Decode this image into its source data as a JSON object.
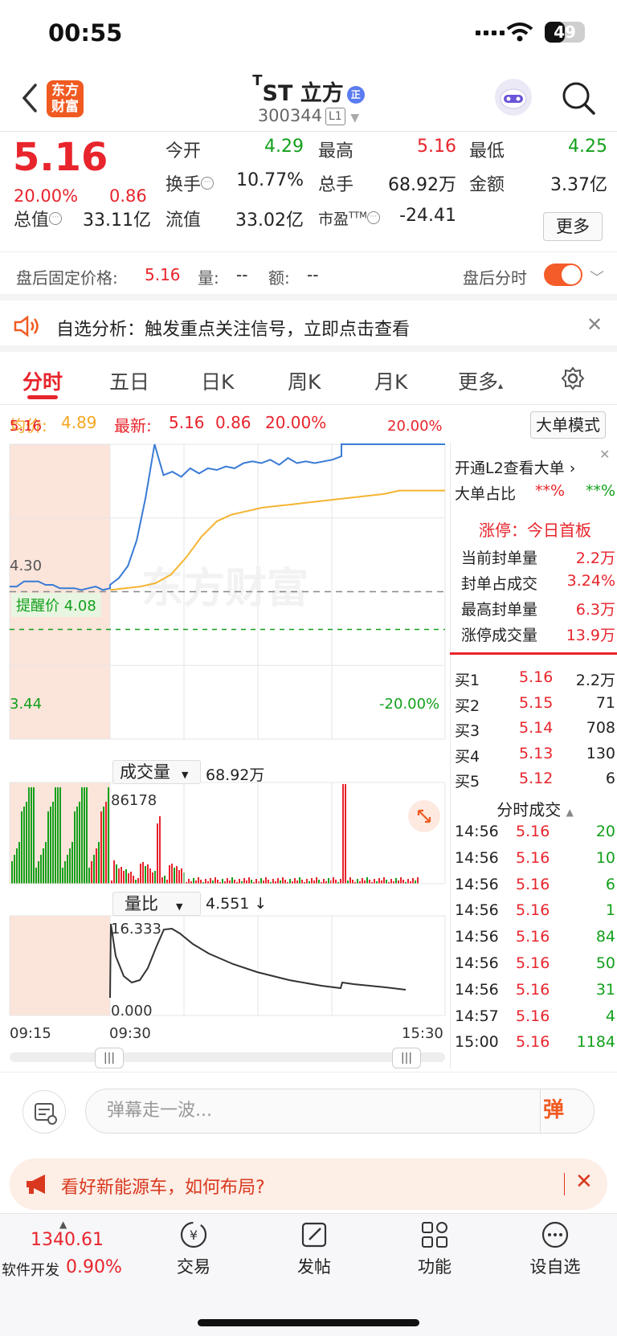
{
  "status": {
    "time": "00:55",
    "battery": "49",
    "battery_level": 0.49
  },
  "nav": {
    "title_sup": "T",
    "title": "ST 立方",
    "badge": "正",
    "code": "300344",
    "level": "L1",
    "logo_line1": "东方",
    "logo_line2": "财富"
  },
  "quote": {
    "price": "5.16",
    "pct": "20.00%",
    "change": "0.86",
    "open_label": "今开",
    "open": "4.29",
    "high_label": "最高",
    "high": "5.16",
    "low_label": "最低",
    "low": "4.25",
    "turnover_label": "换手",
    "turnover": "10.77%",
    "volume_label": "总手",
    "volume": "68.92万",
    "amount_label": "金额",
    "amount": "3.37亿",
    "mcap_label": "总值",
    "mcap": "33.11亿",
    "float_label": "流值",
    "float": "33.02亿",
    "pe_label": "市盈",
    "pe_sup": "TTM",
    "pe": "-24.41",
    "more": "更多"
  },
  "after_hours": {
    "label": "盘后固定价格:",
    "price": "5.16",
    "vol_label": "量:",
    "vol": "--",
    "amt_label": "额:",
    "amt": "--",
    "timeshare": "盘后分时"
  },
  "alert": {
    "text": "自选分析：触发重点关注信号，立即点击查看"
  },
  "tabs": [
    "分时",
    "五日",
    "日K",
    "周K",
    "月K",
    "更多"
  ],
  "legend": {
    "avg_label": "均价:",
    "avg": "4.89",
    "latest_label": "最新:",
    "latest": "5.16",
    "chg": "0.86",
    "pct": "20.00%",
    "mode": "大单模式"
  },
  "chart_data": {
    "type": "line",
    "price_axis": {
      "top": "5.16",
      "base": "4.30",
      "bottom": "3.44",
      "top_pct": "20.00%",
      "bottom_pct": "-20.00%",
      "ylim": [
        3.44,
        5.16
      ]
    },
    "alert_price_label": "提醒价 4.08",
    "alert_price": 4.08,
    "times": [
      "09:15",
      "09:30",
      "15:30"
    ],
    "price": [
      4.33,
      4.33,
      4.36,
      4.36,
      4.36,
      4.34,
      4.34,
      4.32,
      4.32,
      4.32,
      4.31,
      4.32,
      4.33,
      4.31,
      4.32,
      4.34,
      4.38,
      4.45,
      4.6,
      4.85,
      5.16,
      4.98,
      5.0,
      4.97,
      5.02,
      4.99,
      5.02,
      5.01,
      5.03,
      5.02,
      5.05,
      5.06,
      5.05,
      5.07,
      5.04,
      5.08,
      5.05,
      5.06,
      5.05,
      5.06,
      5.07,
      5.09,
      5.16,
      5.16,
      5.16,
      5.16,
      5.16,
      5.16,
      5.16,
      5.16,
      5.16
    ],
    "price_start_index": 0,
    "avg": [
      4.31,
      4.32,
      4.33,
      4.35,
      4.4,
      4.5,
      4.62,
      4.71,
      4.75,
      4.77,
      4.79,
      4.8,
      4.81,
      4.82,
      4.83,
      4.84,
      4.85,
      4.86,
      4.87,
      4.89,
      4.89,
      4.89,
      4.89
    ],
    "volume_label": "成交量",
    "volume_total": "68.92万",
    "volume_max": "86178",
    "ratio_label": "量比",
    "ratio_value": "4.551 ↓",
    "ratio_max": "16.333",
    "ratio_min": "0.000"
  },
  "side": {
    "l2": "开通L2查看大单 ›",
    "big_ratio_label": "大单占比",
    "big_buy": "**%",
    "big_sell": "**%",
    "limit_title": "涨停：今日首板",
    "stats": [
      {
        "label": "当前封单量",
        "value": "2.2万"
      },
      {
        "label": "封单占成交",
        "value": "3.24%"
      },
      {
        "label": "最高封单量",
        "value": "6.3万"
      },
      {
        "label": "涨停成交量",
        "value": "13.9万"
      }
    ],
    "bids": [
      {
        "label": "买1",
        "price": "5.16",
        "vol": "2.2万"
      },
      {
        "label": "买2",
        "price": "5.15",
        "vol": "71"
      },
      {
        "label": "买3",
        "price": "5.14",
        "vol": "708"
      },
      {
        "label": "买4",
        "price": "5.13",
        "vol": "130"
      },
      {
        "label": "买5",
        "price": "5.12",
        "vol": "6"
      }
    ],
    "ticks_title": "分时成交",
    "ticks": [
      {
        "time": "14:56",
        "price": "5.16",
        "vol": "20"
      },
      {
        "time": "14:56",
        "price": "5.16",
        "vol": "10"
      },
      {
        "time": "14:56",
        "price": "5.16",
        "vol": "6"
      },
      {
        "time": "14:56",
        "price": "5.16",
        "vol": "1"
      },
      {
        "time": "14:56",
        "price": "5.16",
        "vol": "84"
      },
      {
        "time": "14:56",
        "price": "5.16",
        "vol": "50"
      },
      {
        "time": "14:56",
        "price": "5.16",
        "vol": "31"
      },
      {
        "time": "14:57",
        "price": "5.16",
        "vol": "4"
      },
      {
        "time": "15:00",
        "price": "5.16",
        "vol": "1184"
      }
    ]
  },
  "danmu": {
    "placeholder": "弹幕走一波...",
    "send": "弹"
  },
  "banner": {
    "text": "看好新能源车，如何布局?"
  },
  "tabbar": {
    "index": "1340.61",
    "index_name": "软件开发",
    "index_pct": "0.90%",
    "items": [
      "交易",
      "发帖",
      "功能",
      "设自选"
    ]
  },
  "colors": {
    "up": "#e8242c",
    "down": "#13a01b",
    "price_line": "#3a7bd5",
    "avg_line": "#f5b431",
    "preopen_bg": "#fbe4da",
    "accent": "#f05a21"
  }
}
